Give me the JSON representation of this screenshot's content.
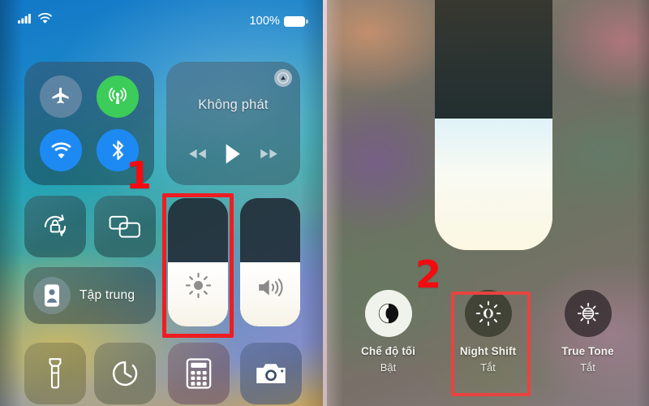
{
  "meta": {
    "app": "iOS Control Center",
    "tutorial_language": "vi"
  },
  "left_panel": {
    "status_bar": {
      "cellular_icon": "signal-bars-icon",
      "wifi_icon": "wifi-icon",
      "battery_percent": "100%",
      "battery_icon": "battery-full-icon"
    },
    "connectivity": {
      "airplane": {
        "name": "airplane-mode",
        "icon": "airplane-icon",
        "state": "off"
      },
      "cellular": {
        "name": "cellular-data",
        "icon": "cellular-antenna-icon",
        "state": "on"
      },
      "wifi": {
        "name": "wifi",
        "icon": "wifi-icon",
        "state": "on"
      },
      "bluetooth": {
        "name": "bluetooth",
        "icon": "bluetooth-icon",
        "state": "on"
      }
    },
    "media": {
      "title": "Không phát",
      "airplay_icon": "airplay-icon",
      "rewind_icon": "rewind-icon",
      "play_icon": "play-icon",
      "forward_icon": "fast-forward-icon"
    },
    "rotation_lock": {
      "label": "",
      "icon": "rotation-lock-icon",
      "state": "off"
    },
    "screen_mirroring": {
      "label": "",
      "icon": "screen-mirroring-icon",
      "state": "off"
    },
    "focus": {
      "label": "Tập trung",
      "icon": "focus-moon-icon",
      "state": "off"
    },
    "brightness_slider": {
      "icon": "brightness-sun-icon",
      "value_percent": 50
    },
    "volume_slider": {
      "icon": "volume-speaker-icon",
      "value_percent": 50
    },
    "shortcuts": [
      {
        "name": "flashlight",
        "icon": "flashlight-icon"
      },
      {
        "name": "timer",
        "icon": "timer-icon"
      },
      {
        "name": "calculator",
        "icon": "calculator-icon"
      },
      {
        "name": "camera",
        "icon": "camera-icon"
      }
    ]
  },
  "right_panel": {
    "expanded_brightness": {
      "icon": "brightness-sun-icon",
      "value_percent": 48
    },
    "display_toggles": [
      {
        "name": "dark-mode",
        "label": "Chế độ tối",
        "state_label": "Bật",
        "icon": "dark-mode-icon",
        "active": true
      },
      {
        "name": "night-shift",
        "label": "Night Shift",
        "state_label": "Tắt",
        "icon": "night-shift-icon",
        "active": false
      },
      {
        "name": "true-tone",
        "label": "True Tone",
        "state_label": "Tắt",
        "icon": "true-tone-icon",
        "active": false
      }
    ]
  },
  "annotations": {
    "step_one": "1",
    "step_two": "2",
    "highlight_color": "#ee1d21",
    "step_color": "#f40b10"
  }
}
